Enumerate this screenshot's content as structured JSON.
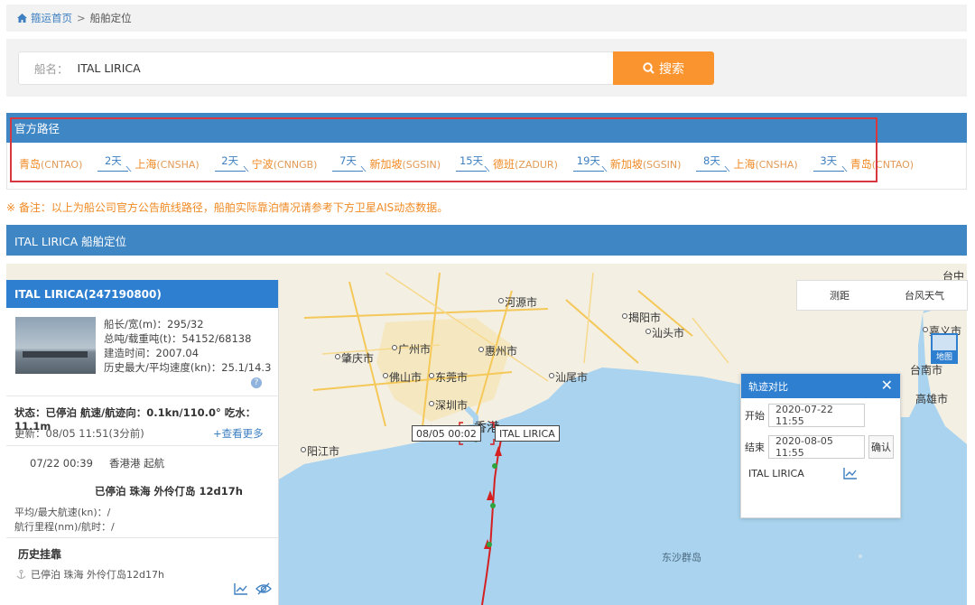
{
  "breadcrumb": {
    "home": "箍运首页",
    "separator": ">",
    "current": "船舶定位"
  },
  "search": {
    "label": "船名：",
    "value": "ITAL LIRICA",
    "button": "搜索"
  },
  "route": {
    "title": "官方路径",
    "stops": [
      {
        "name": "青岛",
        "code": "(CNTAO)"
      },
      {
        "days": "2天",
        "name": "上海",
        "code": "(CNSHA)"
      },
      {
        "days": "2天",
        "name": "宁波",
        "code": "(CNNGB)"
      },
      {
        "days": "7天",
        "name": "新加坡",
        "code": "(SGSIN)"
      },
      {
        "days": "15天",
        "name": "德班",
        "code": "(ZADUR)"
      },
      {
        "days": "19天",
        "name": "新加坡",
        "code": "(SGSIN)"
      },
      {
        "days": "8天",
        "name": "上海",
        "code": "(CNSHA)"
      },
      {
        "days": "3天",
        "name": "青岛",
        "code": "(CNTAO)"
      }
    ]
  },
  "note": "※ 备注：以上为船公司官方公告航线路径，船舶实际靠泊情况请参考下方卫星AIS动态数据。",
  "position_title": "ITAL LIRICA 船舶定位",
  "vessel": {
    "title": "ITAL LIRICA(247190800)",
    "specs": [
      "船长/宽(m)：295/32",
      "总吨/载重吨(t)：54152/68138",
      "建造时间：2007.04",
      "历史最大/平均速度(kn)：25.1/14.3"
    ],
    "status": "状态：已停泊 航速/航迹向：0.1kn/110.0° 吃水：11.1m",
    "update": "更新：08/05 11:51(3分前)",
    "more": "+查看更多",
    "depart_time": "07/22 00:39",
    "depart_text": "香港港 起航",
    "moored": "已停泊 珠海 外伶仃岛 12d17h",
    "speed_stat": "平均/最大航速(kn)：/",
    "distance_stat": "航行里程(nm)/航时：/",
    "history_title": "历史挂靠",
    "history_item": "已停泊 珠海 外伶仃岛12d17h"
  },
  "map": {
    "tools": [
      "测距",
      "台风天气"
    ],
    "toggle": "地图",
    "ship_label": "ITAL LIRICA",
    "time_label": "08/05 00:02",
    "cities": {
      "taizhong": "台中",
      "heyuan": "河源市",
      "jieyang": "揭阳市",
      "shantou": "汕头市",
      "jiayi": "嘉义市",
      "zhaoqing": "肇庆市",
      "guangzhou": "广州市",
      "huizhou": "惠州市",
      "foshan": "佛山市",
      "dongguan": "东莞市",
      "shanwei": "汕尾市",
      "tainan": "台南市",
      "gaoxiong": "高雄市",
      "shenzhen": "深圳市",
      "hongkong": "香港",
      "macau": "澳门",
      "yangjiang": "阳江市",
      "dongsha": "东沙群岛"
    }
  },
  "compare": {
    "title": "轨迹对比",
    "start_label": "开始",
    "start_value": "2020-07-22 11:55",
    "end_label": "结束",
    "end_value": "2020-08-05 11:55",
    "confirm": "确认",
    "ship": "ITAL LIRICA"
  },
  "colors": {
    "header_blue": "#3f86c4",
    "accent_orange": "#f9942e",
    "highlight_red": "#d7373f",
    "track_red": "#d42020"
  }
}
